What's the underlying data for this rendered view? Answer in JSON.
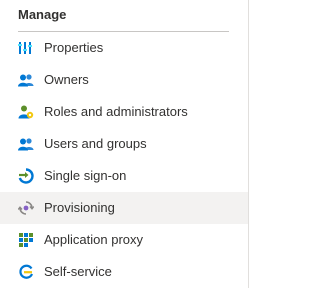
{
  "section": {
    "title": "Manage"
  },
  "menu": {
    "items": [
      {
        "label": "Properties",
        "icon": "properties-icon",
        "selected": false
      },
      {
        "label": "Owners",
        "icon": "owners-icon",
        "selected": false
      },
      {
        "label": "Roles and administrators",
        "icon": "roles-icon",
        "selected": false
      },
      {
        "label": "Users and groups",
        "icon": "users-groups-icon",
        "selected": false
      },
      {
        "label": "Single sign-on",
        "icon": "single-sign-on-icon",
        "selected": false
      },
      {
        "label": "Provisioning",
        "icon": "provisioning-icon",
        "selected": true
      },
      {
        "label": "Application proxy",
        "icon": "application-proxy-icon",
        "selected": false
      },
      {
        "label": "Self-service",
        "icon": "self-service-icon",
        "selected": false
      }
    ]
  },
  "colors": {
    "text": "#323130",
    "selected_background": "#f3f2f1",
    "divider": "#c8c6c4",
    "icon_blue": "#0078d4",
    "icon_teal": "#2b88d8",
    "icon_green": "#5c8f2a"
  }
}
